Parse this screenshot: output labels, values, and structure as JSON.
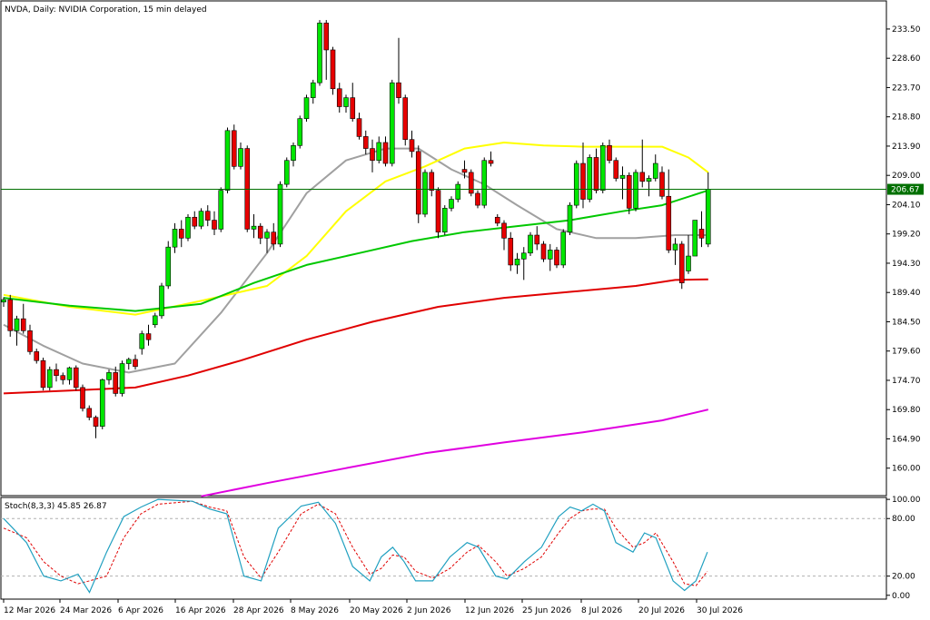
{
  "header": {
    "title": "NVDA, Daily:  NVIDIA Corporation, 15 min delayed"
  },
  "colors": {
    "bull": "#00e600",
    "bear": "#e60000",
    "ma_fast": "#a0a0a0",
    "ma_mid": "#ffff00",
    "ma_slow": "#00c800",
    "ma_red": "#e00000",
    "ma_magenta": "#e000e0",
    "price_line": "#007000",
    "stoch_k": "#20a0c0",
    "stoch_d": "#e00000"
  },
  "chart_data": {
    "type": "candlestick",
    "price_axis": {
      "ylim": [
        155.4,
        238.2
      ],
      "ticks": [
        "233.50",
        "228.60",
        "223.70",
        "218.80",
        "213.90",
        "209.00",
        "204.10",
        "199.20",
        "194.30",
        "189.40",
        "184.50",
        "179.60",
        "174.70",
        "169.80",
        "164.90",
        "160.00"
      ]
    },
    "current_price": "206.67",
    "date_ticks": [
      "12 Mar 2026",
      "24 Mar 2026",
      "6 Apr 2026",
      "16 Apr 2026",
      "28 Apr 2026",
      "8 May 2026",
      "20 May 2026",
      "2 Jun 2026",
      "12 Jun 2026",
      "25 Jun 2026",
      "8 Jul 2026",
      "20 Jul 2026",
      "30 Jul 2026"
    ],
    "candles": [
      [
        187.8,
        188.6,
        187.0,
        188.2
      ],
      [
        188.2,
        189.0,
        182.0,
        183.0
      ],
      [
        183.0,
        185.5,
        180.5,
        185.0
      ],
      [
        185.0,
        187.5,
        182.5,
        183.0
      ],
      [
        183.0,
        184.0,
        179.0,
        179.5
      ],
      [
        179.5,
        180.0,
        177.5,
        178.0
      ],
      [
        178.0,
        178.5,
        173.0,
        173.5
      ],
      [
        173.5,
        177.0,
        173.0,
        176.5
      ],
      [
        176.5,
        177.5,
        174.5,
        175.5
      ],
      [
        175.5,
        176.0,
        174.0,
        174.8
      ],
      [
        174.8,
        177.0,
        174.0,
        176.8
      ],
      [
        176.8,
        177.2,
        173.0,
        173.5
      ],
      [
        173.5,
        174.0,
        169.5,
        170.0
      ],
      [
        170.0,
        170.5,
        168.0,
        168.5
      ],
      [
        168.5,
        168.8,
        165.0,
        167.0
      ],
      [
        167.0,
        175.0,
        166.5,
        174.8
      ],
      [
        174.8,
        176.5,
        174.0,
        176.0
      ],
      [
        176.0,
        177.0,
        172.0,
        172.5
      ],
      [
        172.5,
        178.0,
        172.0,
        177.5
      ],
      [
        177.5,
        178.5,
        176.5,
        178.2
      ],
      [
        178.2,
        179.0,
        176.5,
        177.0
      ],
      [
        180.0,
        183.0,
        179.0,
        182.5
      ],
      [
        182.5,
        184.0,
        180.5,
        181.5
      ],
      [
        184.0,
        186.0,
        183.5,
        185.5
      ],
      [
        185.5,
        191.0,
        185.0,
        190.5
      ],
      [
        190.5,
        198.0,
        190.0,
        197.0
      ],
      [
        197.0,
        201.0,
        196.0,
        200.0
      ],
      [
        200.0,
        201.5,
        197.0,
        198.5
      ],
      [
        198.5,
        202.5,
        198.0,
        202.0
      ],
      [
        202.0,
        203.0,
        200.0,
        200.5
      ],
      [
        200.5,
        203.5,
        200.0,
        203.0
      ],
      [
        203.0,
        204.0,
        200.5,
        201.5
      ],
      [
        201.5,
        203.0,
        199.0,
        200.0
      ],
      [
        200.0,
        207.0,
        199.5,
        206.5
      ],
      [
        206.5,
        217.0,
        206.0,
        216.5
      ],
      [
        216.5,
        217.5,
        210.0,
        210.5
      ],
      [
        210.5,
        214.5,
        210.0,
        213.5
      ],
      [
        213.5,
        214.0,
        199.5,
        200.0
      ],
      [
        200.0,
        202.5,
        198.5,
        200.5
      ],
      [
        200.5,
        201.0,
        197.5,
        198.5
      ],
      [
        198.5,
        200.0,
        196.0,
        199.5
      ],
      [
        199.5,
        201.0,
        196.5,
        197.5
      ],
      [
        197.5,
        208.0,
        197.0,
        207.5
      ],
      [
        207.5,
        212.0,
        207.0,
        211.5
      ],
      [
        211.5,
        214.5,
        210.5,
        214.0
      ],
      [
        214.0,
        219.0,
        213.5,
        218.5
      ],
      [
        218.5,
        222.5,
        218.0,
        222.0
      ],
      [
        222.0,
        225.0,
        221.0,
        224.5
      ],
      [
        224.5,
        235.0,
        224.0,
        234.5
      ],
      [
        234.5,
        235.0,
        225.0,
        230.0
      ],
      [
        230.0,
        230.5,
        222.5,
        223.5
      ],
      [
        223.5,
        224.5,
        219.5,
        220.5
      ],
      [
        220.5,
        222.5,
        219.5,
        222.0
      ],
      [
        222.0,
        224.5,
        218.0,
        218.5
      ],
      [
        218.5,
        219.5,
        215.0,
        215.5
      ],
      [
        215.5,
        216.5,
        212.5,
        213.5
      ],
      [
        213.5,
        215.0,
        209.5,
        211.5
      ],
      [
        211.5,
        215.5,
        211.0,
        214.5
      ],
      [
        214.5,
        215.5,
        210.5,
        211.0
      ],
      [
        211.0,
        225.0,
        210.5,
        224.5
      ],
      [
        224.5,
        232.0,
        221.0,
        222.0
      ],
      [
        222.0,
        222.5,
        214.0,
        215.0
      ],
      [
        215.0,
        216.5,
        212.0,
        213.0
      ],
      [
        213.0,
        214.0,
        201.0,
        202.5
      ],
      [
        202.5,
        210.0,
        202.0,
        209.5
      ],
      [
        209.5,
        210.0,
        205.5,
        206.5
      ],
      [
        206.5,
        207.0,
        198.5,
        199.5
      ],
      [
        199.5,
        204.0,
        199.0,
        203.5
      ],
      [
        203.5,
        205.5,
        203.0,
        205.0
      ],
      [
        205.0,
        208.0,
        204.5,
        207.5
      ],
      [
        210.0,
        211.5,
        208.5,
        209.5
      ],
      [
        209.5,
        210.0,
        205.5,
        206.0
      ],
      [
        206.0,
        206.5,
        203.5,
        204.0
      ],
      [
        204.0,
        212.0,
        203.5,
        211.5
      ],
      [
        211.5,
        213.0,
        210.5,
        211.0
      ],
      [
        202.0,
        202.5,
        200.5,
        201.0
      ],
      [
        201.0,
        201.5,
        196.5,
        198.5
      ],
      [
        198.5,
        199.5,
        193.0,
        194.0
      ],
      [
        194.0,
        196.0,
        192.5,
        195.0
      ],
      [
        195.0,
        197.0,
        191.5,
        196.0
      ],
      [
        196.0,
        199.5,
        195.5,
        199.0
      ],
      [
        199.0,
        200.5,
        196.5,
        197.5
      ],
      [
        197.5,
        198.0,
        194.5,
        195.0
      ],
      [
        195.0,
        197.5,
        193.0,
        196.5
      ],
      [
        196.5,
        197.0,
        193.5,
        194.0
      ],
      [
        194.0,
        200.0,
        193.5,
        199.5
      ],
      [
        199.5,
        204.5,
        199.0,
        204.0
      ],
      [
        204.0,
        211.5,
        203.5,
        211.0
      ],
      [
        211.0,
        214.5,
        203.5,
        205.0
      ],
      [
        205.0,
        212.5,
        204.5,
        212.0
      ],
      [
        212.0,
        213.5,
        206.0,
        206.5
      ],
      [
        206.5,
        214.5,
        206.0,
        214.0
      ],
      [
        214.0,
        215.0,
        211.0,
        211.5
      ],
      [
        211.5,
        212.0,
        208.0,
        208.5
      ],
      [
        208.5,
        210.5,
        205.0,
        209.0
      ],
      [
        209.0,
        209.5,
        202.5,
        203.5
      ],
      [
        203.5,
        210.0,
        203.0,
        209.5
      ],
      [
        209.5,
        215.0,
        207.0,
        208.0
      ],
      [
        208.0,
        209.0,
        205.5,
        208.5
      ],
      [
        208.5,
        212.5,
        208.0,
        211.0
      ],
      [
        209.5,
        210.5,
        205.0,
        205.5
      ],
      [
        205.5,
        210.0,
        196.0,
        196.5
      ],
      [
        196.5,
        198.5,
        194.0,
        197.5
      ],
      [
        197.5,
        198.0,
        190.0,
        191.0
      ],
      [
        193.0,
        199.0,
        192.5,
        195.5
      ],
      [
        195.5,
        197.5,
        196.5,
        201.5
      ],
      [
        200.0,
        203.0,
        197.0,
        198.5
      ],
      [
        197.5,
        209.5,
        197.0,
        206.7
      ]
    ],
    "moving_averages": [
      {
        "key": "ma_fast",
        "values": [
          [
            0,
            184.0
          ],
          [
            6,
            180.5
          ],
          [
            12,
            177.5
          ],
          [
            19,
            176.0
          ],
          [
            26,
            177.5
          ],
          [
            33,
            186.0
          ],
          [
            40,
            196.0
          ],
          [
            46,
            206.0
          ],
          [
            52,
            211.5
          ],
          [
            58,
            213.5
          ],
          [
            63,
            213.5
          ],
          [
            68,
            210.0
          ],
          [
            73,
            207.5
          ],
          [
            78,
            204.0
          ],
          [
            84,
            200.0
          ],
          [
            90,
            198.5
          ],
          [
            96,
            198.5
          ],
          [
            102,
            199.0
          ],
          [
            107,
            199.0
          ]
        ]
      },
      {
        "key": "ma_mid",
        "values": [
          [
            0,
            189.0
          ],
          [
            10,
            187.0
          ],
          [
            20,
            185.7
          ],
          [
            30,
            188.0
          ],
          [
            40,
            190.5
          ],
          [
            46,
            195.5
          ],
          [
            52,
            203.0
          ],
          [
            58,
            208.0
          ],
          [
            64,
            210.5
          ],
          [
            70,
            213.5
          ],
          [
            76,
            214.5
          ],
          [
            82,
            214.0
          ],
          [
            88,
            213.8
          ],
          [
            94,
            213.8
          ],
          [
            100,
            213.8
          ],
          [
            104,
            212.0
          ],
          [
            107,
            209.5
          ]
        ]
      },
      {
        "key": "ma_slow",
        "values": [
          [
            0,
            188.5
          ],
          [
            10,
            187.2
          ],
          [
            20,
            186.3
          ],
          [
            30,
            187.5
          ],
          [
            38,
            191.0
          ],
          [
            46,
            194.0
          ],
          [
            54,
            196.0
          ],
          [
            62,
            198.0
          ],
          [
            70,
            199.5
          ],
          [
            78,
            200.5
          ],
          [
            86,
            201.5
          ],
          [
            94,
            203.0
          ],
          [
            100,
            204.0
          ],
          [
            107,
            206.5
          ]
        ]
      },
      {
        "key": "ma_red",
        "values": [
          [
            0,
            172.5
          ],
          [
            10,
            173.0
          ],
          [
            20,
            173.5
          ],
          [
            28,
            175.5
          ],
          [
            36,
            178.0
          ],
          [
            46,
            181.5
          ],
          [
            56,
            184.5
          ],
          [
            66,
            187.0
          ],
          [
            76,
            188.5
          ],
          [
            86,
            189.5
          ],
          [
            96,
            190.5
          ],
          [
            102,
            191.5
          ],
          [
            107,
            191.6
          ]
        ]
      },
      {
        "key": "ma_magenta",
        "values": [
          [
            30,
            155.3
          ],
          [
            40,
            157.5
          ],
          [
            52,
            160.0
          ],
          [
            64,
            162.5
          ],
          [
            76,
            164.3
          ],
          [
            88,
            166.0
          ],
          [
            100,
            168.0
          ],
          [
            107,
            169.8
          ]
        ]
      }
    ],
    "stochastic": {
      "label": "Stoch(8,3,3) 45.85 26.87",
      "ylim": [
        -4,
        102
      ],
      "ticks": [
        "100.00",
        "80.00",
        "20.00",
        "0.00"
      ],
      "k": [
        [
          0,
          80
        ],
        [
          4,
          55
        ],
        [
          7,
          20
        ],
        [
          10,
          15
        ],
        [
          13,
          22
        ],
        [
          15,
          3
        ],
        [
          18,
          45
        ],
        [
          21,
          82
        ],
        [
          24,
          92
        ],
        [
          27,
          100
        ],
        [
          33,
          98
        ],
        [
          36,
          90
        ],
        [
          39,
          85
        ],
        [
          42,
          20
        ],
        [
          45,
          15
        ],
        [
          48,
          70
        ],
        [
          52,
          93
        ],
        [
          55,
          97
        ],
        [
          58,
          75
        ],
        [
          61,
          30
        ],
        [
          64,
          15
        ],
        [
          66,
          40
        ],
        [
          68,
          50
        ],
        [
          70,
          35
        ],
        [
          72,
          15
        ],
        [
          75,
          15
        ],
        [
          78,
          40
        ],
        [
          81,
          55
        ],
        [
          83,
          50
        ],
        [
          86,
          20
        ],
        [
          88,
          17
        ],
        [
          91,
          35
        ],
        [
          94,
          50
        ],
        [
          97,
          82
        ],
        [
          99,
          92
        ],
        [
          101,
          88
        ],
        [
          103,
          95
        ],
        [
          105,
          88
        ],
        [
          107,
          55
        ],
        [
          110,
          45
        ],
        [
          112,
          65
        ],
        [
          114,
          60
        ],
        [
          117,
          15
        ],
        [
          119,
          5
        ],
        [
          121,
          15
        ],
        [
          123,
          45
        ]
      ],
      "d": [
        [
          0,
          70
        ],
        [
          4,
          60
        ],
        [
          7,
          35
        ],
        [
          10,
          20
        ],
        [
          13,
          12
        ],
        [
          15,
          15
        ],
        [
          18,
          20
        ],
        [
          21,
          60
        ],
        [
          24,
          85
        ],
        [
          27,
          95
        ],
        [
          33,
          98
        ],
        [
          36,
          92
        ],
        [
          39,
          88
        ],
        [
          42,
          40
        ],
        [
          45,
          18
        ],
        [
          48,
          45
        ],
        [
          52,
          85
        ],
        [
          55,
          95
        ],
        [
          58,
          85
        ],
        [
          61,
          50
        ],
        [
          64,
          22
        ],
        [
          66,
          28
        ],
        [
          68,
          42
        ],
        [
          70,
          40
        ],
        [
          72,
          25
        ],
        [
          75,
          18
        ],
        [
          78,
          28
        ],
        [
          81,
          45
        ],
        [
          83,
          52
        ],
        [
          86,
          35
        ],
        [
          88,
          20
        ],
        [
          91,
          28
        ],
        [
          94,
          40
        ],
        [
          97,
          65
        ],
        [
          99,
          80
        ],
        [
          101,
          88
        ],
        [
          103,
          90
        ],
        [
          105,
          90
        ],
        [
          107,
          70
        ],
        [
          110,
          50
        ],
        [
          112,
          55
        ],
        [
          114,
          65
        ],
        [
          117,
          35
        ],
        [
          119,
          12
        ],
        [
          121,
          10
        ],
        [
          123,
          25
        ]
      ]
    }
  }
}
